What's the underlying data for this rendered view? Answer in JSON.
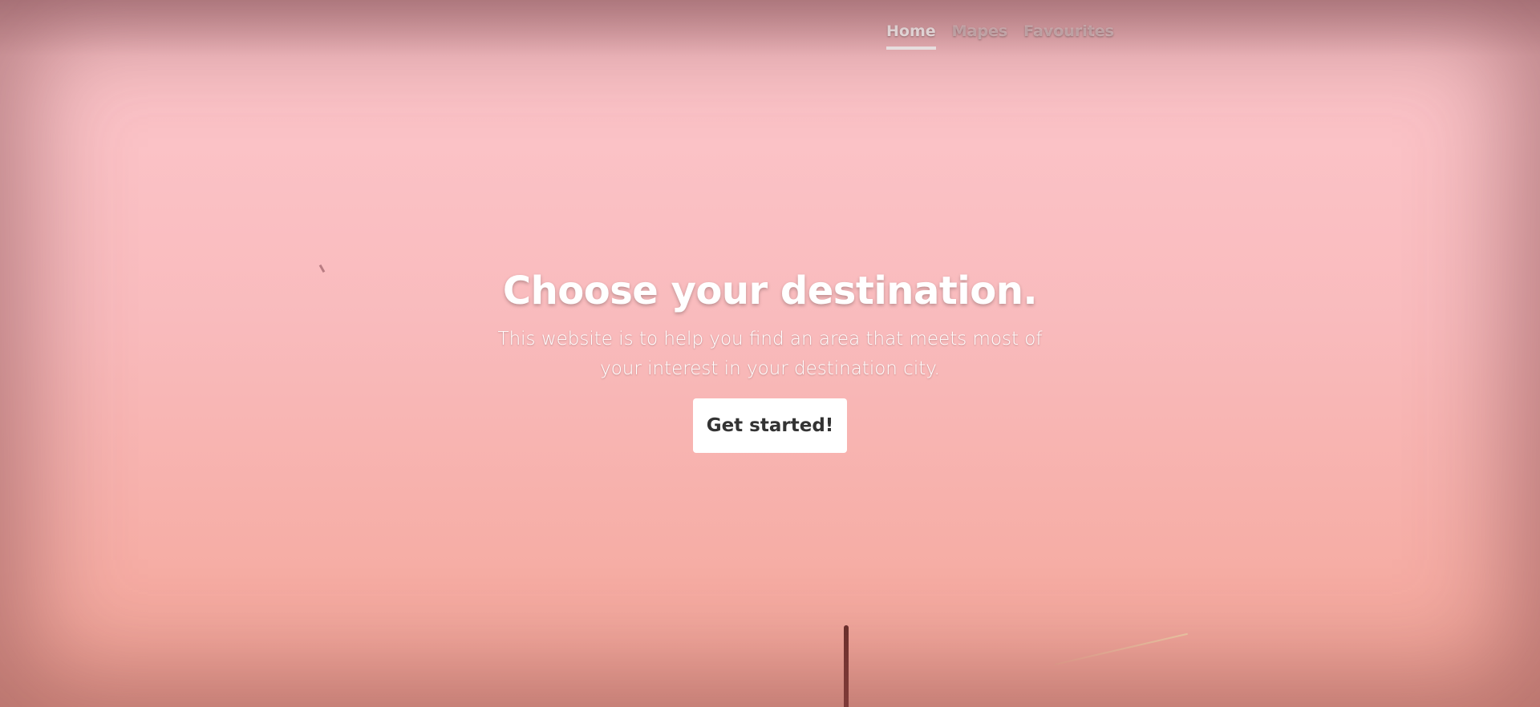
{
  "nav": {
    "items": [
      {
        "label": "Home",
        "active": true
      },
      {
        "label": "Mapes",
        "active": false
      },
      {
        "label": "Favourites",
        "active": false
      }
    ]
  },
  "hero": {
    "title": "Choose your destination.",
    "subtitle": "This website is to help you find an area that meets most of your interest in your destination city.",
    "cta_label": "Get started!"
  },
  "colors": {
    "background_top": "#fbc4c9",
    "background_bottom": "#f4a596",
    "text": "#ffffff",
    "button_bg": "#ffffff",
    "button_text": "#333333"
  }
}
